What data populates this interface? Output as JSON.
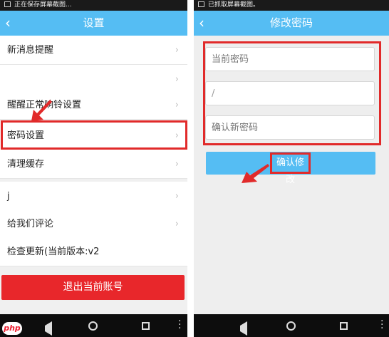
{
  "left_screen": {
    "status_text": "正在保存屏幕截图...",
    "title": "设置",
    "back_icon": "chevron-left-icon",
    "items": [
      {
        "label": "新消息提醒"
      },
      {
        "label": ""
      },
      {
        "label": "醒醒正常响铃设置"
      },
      {
        "label": "密码设置"
      },
      {
        "label": "清理缓存"
      },
      {
        "label": "j"
      },
      {
        "label": "给我们评论"
      },
      {
        "label": "检查更新(当前版本:v2"
      }
    ],
    "chevron": "›",
    "logout_label": "退出当前账号"
  },
  "right_screen": {
    "status_text": "已抓取屏幕截图。",
    "title": "修改密码",
    "back_icon": "chevron-left-icon",
    "current_password_placeholder": "当前密码",
    "new_password_value": "/",
    "confirm_password_placeholder": "确认新密码",
    "confirm_label": "确认修改"
  },
  "watermark": "php",
  "colors": {
    "titlebar": "#55bdf3",
    "logout": "#e8272b",
    "highlight": "#e12a2a"
  }
}
